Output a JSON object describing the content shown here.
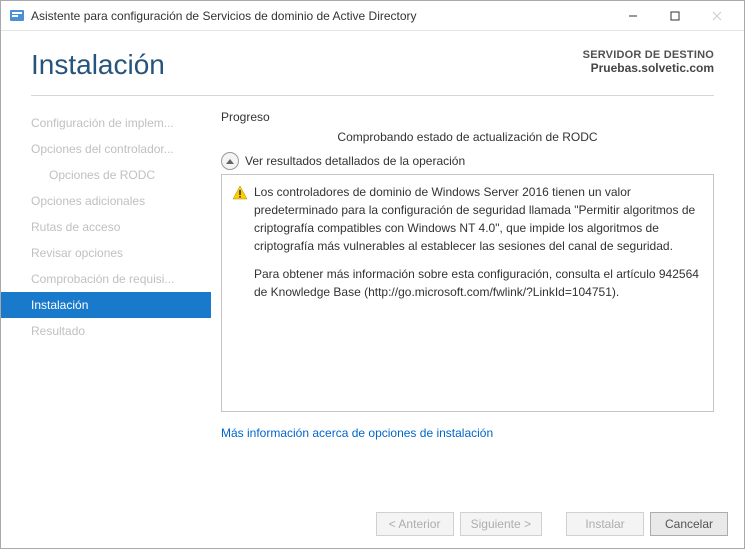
{
  "window": {
    "title": "Asistente para configuración de Servicios de dominio de Active Directory"
  },
  "header": {
    "title": "Instalación",
    "destination_label": "SERVIDOR DE DESTINO",
    "destination_value": "Pruebas.solvetic.com"
  },
  "sidebar": {
    "items": [
      {
        "label": "Configuración de implem...",
        "indent": false,
        "active": false
      },
      {
        "label": "Opciones del controlador...",
        "indent": false,
        "active": false
      },
      {
        "label": "Opciones de RODC",
        "indent": true,
        "active": false
      },
      {
        "label": "Opciones adicionales",
        "indent": false,
        "active": false
      },
      {
        "label": "Rutas de acceso",
        "indent": false,
        "active": false
      },
      {
        "label": "Revisar opciones",
        "indent": false,
        "active": false
      },
      {
        "label": "Comprobación de requisi...",
        "indent": false,
        "active": false
      },
      {
        "label": "Instalación",
        "indent": false,
        "active": true
      },
      {
        "label": "Resultado",
        "indent": false,
        "active": false
      }
    ]
  },
  "pane": {
    "progress_label": "Progreso",
    "status": "Comprobando estado de actualización de RODC",
    "expander_label": "Ver resultados detallados de la operación",
    "warning_p1": "Los controladores de dominio de Windows Server 2016 tienen un valor predeterminado para la configuración de seguridad llamada \"Permitir algoritmos de criptografía compatibles con Windows NT 4.0\", que impide los algoritmos de criptografía más vulnerables al establecer las sesiones del canal de seguridad.",
    "warning_p2": "Para obtener más información sobre esta configuración, consulta el artículo 942564 de Knowledge Base (http://go.microsoft.com/fwlink/?LinkId=104751).",
    "more_info_link": "Más información acerca de opciones de instalación"
  },
  "buttons": {
    "prev": "< Anterior",
    "next": "Siguiente >",
    "install": "Instalar",
    "cancel": "Cancelar"
  }
}
